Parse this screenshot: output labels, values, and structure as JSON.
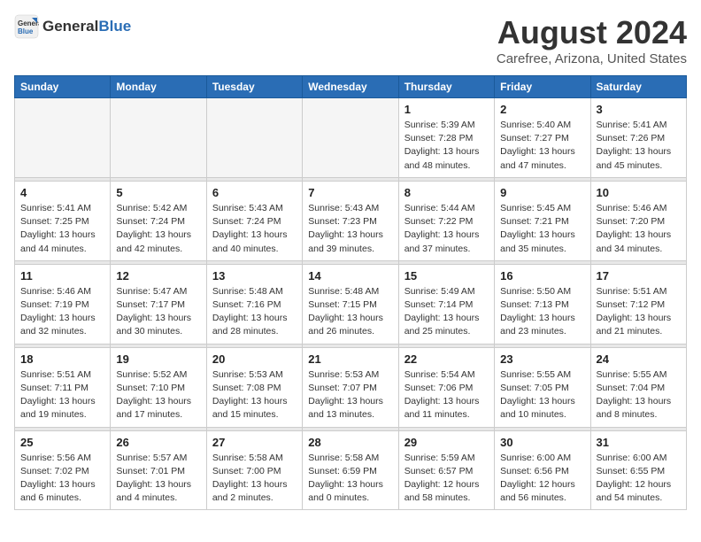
{
  "logo": {
    "general": "General",
    "blue": "Blue"
  },
  "header": {
    "month_year": "August 2024",
    "location": "Carefree, Arizona, United States"
  },
  "weekdays": [
    "Sunday",
    "Monday",
    "Tuesday",
    "Wednesday",
    "Thursday",
    "Friday",
    "Saturday"
  ],
  "weeks": [
    [
      {
        "day": "",
        "info": ""
      },
      {
        "day": "",
        "info": ""
      },
      {
        "day": "",
        "info": ""
      },
      {
        "day": "",
        "info": ""
      },
      {
        "day": "1",
        "info": "Sunrise: 5:39 AM\nSunset: 7:28 PM\nDaylight: 13 hours\nand 48 minutes."
      },
      {
        "day": "2",
        "info": "Sunrise: 5:40 AM\nSunset: 7:27 PM\nDaylight: 13 hours\nand 47 minutes."
      },
      {
        "day": "3",
        "info": "Sunrise: 5:41 AM\nSunset: 7:26 PM\nDaylight: 13 hours\nand 45 minutes."
      }
    ],
    [
      {
        "day": "4",
        "info": "Sunrise: 5:41 AM\nSunset: 7:25 PM\nDaylight: 13 hours\nand 44 minutes."
      },
      {
        "day": "5",
        "info": "Sunrise: 5:42 AM\nSunset: 7:24 PM\nDaylight: 13 hours\nand 42 minutes."
      },
      {
        "day": "6",
        "info": "Sunrise: 5:43 AM\nSunset: 7:24 PM\nDaylight: 13 hours\nand 40 minutes."
      },
      {
        "day": "7",
        "info": "Sunrise: 5:43 AM\nSunset: 7:23 PM\nDaylight: 13 hours\nand 39 minutes."
      },
      {
        "day": "8",
        "info": "Sunrise: 5:44 AM\nSunset: 7:22 PM\nDaylight: 13 hours\nand 37 minutes."
      },
      {
        "day": "9",
        "info": "Sunrise: 5:45 AM\nSunset: 7:21 PM\nDaylight: 13 hours\nand 35 minutes."
      },
      {
        "day": "10",
        "info": "Sunrise: 5:46 AM\nSunset: 7:20 PM\nDaylight: 13 hours\nand 34 minutes."
      }
    ],
    [
      {
        "day": "11",
        "info": "Sunrise: 5:46 AM\nSunset: 7:19 PM\nDaylight: 13 hours\nand 32 minutes."
      },
      {
        "day": "12",
        "info": "Sunrise: 5:47 AM\nSunset: 7:17 PM\nDaylight: 13 hours\nand 30 minutes."
      },
      {
        "day": "13",
        "info": "Sunrise: 5:48 AM\nSunset: 7:16 PM\nDaylight: 13 hours\nand 28 minutes."
      },
      {
        "day": "14",
        "info": "Sunrise: 5:48 AM\nSunset: 7:15 PM\nDaylight: 13 hours\nand 26 minutes."
      },
      {
        "day": "15",
        "info": "Sunrise: 5:49 AM\nSunset: 7:14 PM\nDaylight: 13 hours\nand 25 minutes."
      },
      {
        "day": "16",
        "info": "Sunrise: 5:50 AM\nSunset: 7:13 PM\nDaylight: 13 hours\nand 23 minutes."
      },
      {
        "day": "17",
        "info": "Sunrise: 5:51 AM\nSunset: 7:12 PM\nDaylight: 13 hours\nand 21 minutes."
      }
    ],
    [
      {
        "day": "18",
        "info": "Sunrise: 5:51 AM\nSunset: 7:11 PM\nDaylight: 13 hours\nand 19 minutes."
      },
      {
        "day": "19",
        "info": "Sunrise: 5:52 AM\nSunset: 7:10 PM\nDaylight: 13 hours\nand 17 minutes."
      },
      {
        "day": "20",
        "info": "Sunrise: 5:53 AM\nSunset: 7:08 PM\nDaylight: 13 hours\nand 15 minutes."
      },
      {
        "day": "21",
        "info": "Sunrise: 5:53 AM\nSunset: 7:07 PM\nDaylight: 13 hours\nand 13 minutes."
      },
      {
        "day": "22",
        "info": "Sunrise: 5:54 AM\nSunset: 7:06 PM\nDaylight: 13 hours\nand 11 minutes."
      },
      {
        "day": "23",
        "info": "Sunrise: 5:55 AM\nSunset: 7:05 PM\nDaylight: 13 hours\nand 10 minutes."
      },
      {
        "day": "24",
        "info": "Sunrise: 5:55 AM\nSunset: 7:04 PM\nDaylight: 13 hours\nand 8 minutes."
      }
    ],
    [
      {
        "day": "25",
        "info": "Sunrise: 5:56 AM\nSunset: 7:02 PM\nDaylight: 13 hours\nand 6 minutes."
      },
      {
        "day": "26",
        "info": "Sunrise: 5:57 AM\nSunset: 7:01 PM\nDaylight: 13 hours\nand 4 minutes."
      },
      {
        "day": "27",
        "info": "Sunrise: 5:58 AM\nSunset: 7:00 PM\nDaylight: 13 hours\nand 2 minutes."
      },
      {
        "day": "28",
        "info": "Sunrise: 5:58 AM\nSunset: 6:59 PM\nDaylight: 13 hours\nand 0 minutes."
      },
      {
        "day": "29",
        "info": "Sunrise: 5:59 AM\nSunset: 6:57 PM\nDaylight: 12 hours\nand 58 minutes."
      },
      {
        "day": "30",
        "info": "Sunrise: 6:00 AM\nSunset: 6:56 PM\nDaylight: 12 hours\nand 56 minutes."
      },
      {
        "day": "31",
        "info": "Sunrise: 6:00 AM\nSunset: 6:55 PM\nDaylight: 12 hours\nand 54 minutes."
      }
    ]
  ]
}
